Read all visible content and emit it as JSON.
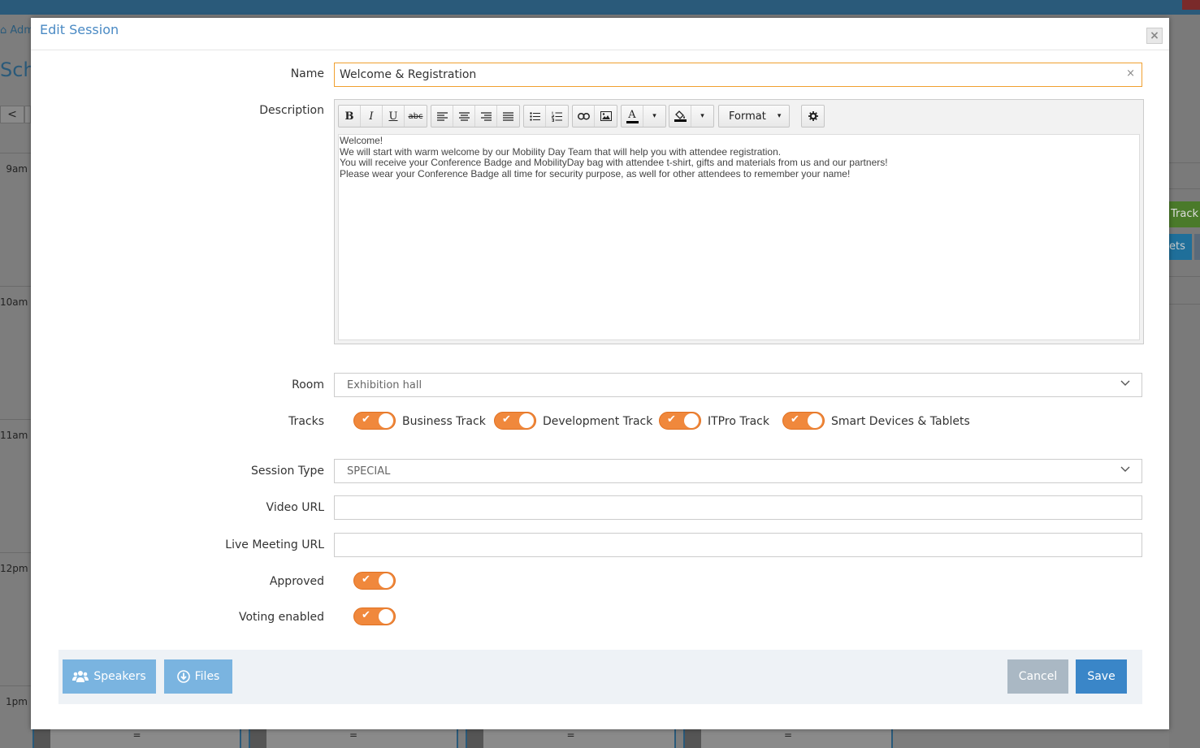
{
  "background": {
    "breadcrumb": "Adm",
    "page_title": "Sche",
    "nav_prev": "<",
    "times": [
      "9am",
      "10am",
      "11am",
      "12pm",
      "1pm"
    ],
    "tracks": [
      "Track",
      "ets"
    ],
    "bottom_marks": [
      "=",
      "=",
      "=",
      "="
    ]
  },
  "modal": {
    "title": "Edit Session",
    "close_icon": "×"
  },
  "form": {
    "name_label": "Name",
    "name_value": "Welcome & Registration",
    "name_clear": "×",
    "description_label": "Description",
    "description_lines": [
      "Welcome!",
      "We will start with warm welcome by our Mobility Day Team that will help you with attendee registration.",
      "You will receive your Conference Badge and MobilityDay bag with attendee t-shirt, gifts and materials from us and our partners!",
      "Please wear your Conference Badge all time for security purpose, as well for other attendees to remember your name!"
    ],
    "toolbar": {
      "bold": "B",
      "italic": "I",
      "underline": "U",
      "strike": "abc",
      "format": "Format",
      "font_color": "A",
      "caret": "▾"
    },
    "room_label": "Room",
    "room_value": "Exhibition hall",
    "tracks_label": "Tracks",
    "tracks": [
      {
        "label": "Business Track",
        "checked": true
      },
      {
        "label": "Development Track",
        "checked": true
      },
      {
        "label": "ITPro Track",
        "checked": true
      },
      {
        "label": "Smart Devices & Tablets",
        "checked": true
      }
    ],
    "session_type_label": "Session Type",
    "session_type_value": "SPECIAL",
    "video_url_label": "Video URL",
    "video_url_value": "",
    "live_url_label": "Live Meeting URL",
    "live_url_value": "",
    "approved_label": "Approved",
    "approved": true,
    "voting_label": "Voting enabled",
    "voting": true
  },
  "footer": {
    "speakers": "Speakers",
    "files": "Files",
    "cancel": "Cancel",
    "save": "Save"
  },
  "colors": {
    "accent": "#f0883c",
    "primary": "#3a86c8",
    "light_button": "#7ab4e0",
    "title": "#4a8ac4"
  }
}
